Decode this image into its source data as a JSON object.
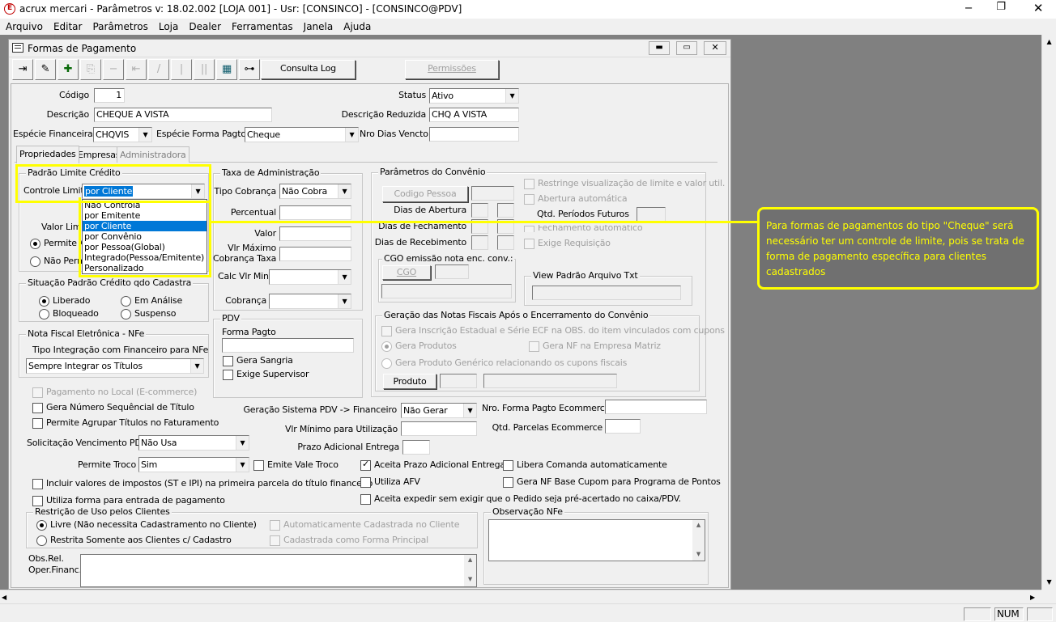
{
  "app": {
    "title": "acrux mercari - Parâmetros  v: 18.02.002  [LOJA 001] - Usr: [CONSINCO] - [CONSINCO@PDV]",
    "logo_letter": "E"
  },
  "menu": [
    "Arquivo",
    "Editar",
    "Parâmetros",
    "Loja",
    "Dealer",
    "Ferramentas",
    "Janela",
    "Ajuda"
  ],
  "child": {
    "title": "Formas de Pagamento"
  },
  "toolbar": {
    "consulta_log": "Consulta Log",
    "permissoes": "Permissões"
  },
  "form": {
    "codigo_label": "Código",
    "codigo_value": "1",
    "status_label": "Status",
    "status_value": "Ativo",
    "descricao_label": "Descrição",
    "descricao_value": "CHEQUE A VISTA",
    "desc_reduzida_label": "Descrição Reduzida",
    "desc_reduzida_value": "CHQ A VISTA",
    "especie_fin_label": "Espécie Financeira",
    "especie_fin_value": "CHQVIS",
    "especie_forma_label": "Espécie Forma Pagto",
    "especie_forma_value": "Cheque",
    "nro_dias_label": "Nro Dias Vencto",
    "nro_dias_value": ""
  },
  "tabs": [
    "Propriedades",
    "Empresas",
    "Administradora"
  ],
  "padrao_limite": {
    "title": "Padrão Limite Crédito",
    "controle_label": "Controle Limite",
    "controle_value": "por Cliente",
    "options": [
      "Não Controla",
      "por Emitente",
      "por Cliente",
      "por Convênio",
      "por Pessoa(Global)",
      "Integrado(Pessoa/Emitente)",
      "Personalizado"
    ],
    "valor_label": "Valor Limi",
    "permite_label": "Permite A",
    "nao_perm_label": "Não Perm"
  },
  "situacao": {
    "title": "Situação Padrão Crédito qdo Cadastra",
    "liberado": "Liberado",
    "em_analise": "Em Análise",
    "bloqueado": "Bloqueado",
    "suspenso": "Suspenso"
  },
  "nfe": {
    "title": "Nota Fiscal Eletrônica - NFe",
    "tipo_label": "Tipo Integração com Financeiro para NFe",
    "tipo_value": "Sempre Integrar os Títulos"
  },
  "taxa": {
    "title": "Taxa de Administração",
    "tipo_cobranca_label": "Tipo Cobrança",
    "tipo_cobranca_value": "Não Cobra",
    "percentual_label": "Percentual",
    "valor_label": "Valor",
    "vlr_max_label1": "Vlr Máximo",
    "vlr_max_label2": "Cobrança Taxa",
    "calc_label": "Calc Vlr Min",
    "cobranca_label": "Cobrança"
  },
  "pdv": {
    "title": "PDV",
    "forma_label": "Forma Pagto",
    "gera_sangria": "Gera Sangria",
    "exige_supervisor": "Exige Supervisor"
  },
  "convenio": {
    "title": "Parâmetros do Convênio",
    "codigo_pessoa_btn": "Codigo Pessoa",
    "dias_abertura": "Dias de Abertura",
    "dias_fechamento": "Dias de Fechamento",
    "dias_recebimento": "Dias de Recebimento",
    "restringe": "Restringe visualização de limite e valor util.",
    "abertura_auto": "Abertura automática",
    "qtd_periodos": "Qtd. Períodos Futuros",
    "fechamento_auto": "Fechamento automático",
    "exige_req": "Exige Requisição",
    "cgo_title": "CGO emissão nota enc. conv.:",
    "cgo_btn": "CGO",
    "view_title": "View Padrão Arquivo Txt"
  },
  "geracao_nf": {
    "title": "Geração das Notas Fiscais Após o Encerramento do Convênio",
    "gera_inscricao": "Gera Inscrição Estadual e Série ECF na OBS. do item vinculados com cupons",
    "gera_produtos": "Gera Produtos",
    "gera_nf_matriz": "Gera NF na Empresa Matriz",
    "gera_generico": "Gera Produto Genérico relacionando os cupons fiscais",
    "produto_btn": "Produto"
  },
  "options": {
    "pagamento_local": "Pagamento no Local (E-commerce)",
    "gera_numero": "Gera Número Sequêncial de Título",
    "permite_agrupar": "Permite Agrupar Títulos no Faturamento",
    "solicitacao_label": "Solicitação Vencimento PDV",
    "solicitacao_value": "Não Usa",
    "permite_troco_label": "Permite Troco",
    "permite_troco_value": "Sim",
    "emite_vale": "Emite Vale Troco",
    "incluir_impostos": "Incluir valores de impostos (ST e IPI) na primeira parcela do título financeiro",
    "utiliza_forma": "Utiliza forma para entrada de pagamento",
    "geracao_pdv_label": "Geração Sistema PDV -> Financeiro",
    "geracao_pdv_value": "Não Gerar",
    "nro_forma_label": "Nro. Forma Pagto Ecommerce",
    "vlr_minimo_label": "Vlr Mínimo para Utilização",
    "qtd_parcelas_label": "Qtd. Parcelas Ecommerce",
    "prazo_label": "Prazo Adicional Entrega",
    "aceita_prazo": "Aceita Prazo Adicional Entrega",
    "libera_comanda": "Libera Comanda automaticamente",
    "utiliza_afv": "Utiliza AFV",
    "gera_nf_base": "Gera NF Base Cupom para Programa de Pontos",
    "aceita_expedir": "Aceita expedir sem exigir que o Pedido seja pré-acertado no caixa/PDV."
  },
  "restricao": {
    "title": "Restrição de Uso pelos Clientes",
    "livre": "Livre (Não necessita Cadastramento no Cliente)",
    "restrita": "Restrita Somente aos Clientes c/ Cadastro",
    "auto_cadastrada": "Automaticamente Cadastrada no Cliente",
    "cadastrada_principal": "Cadastrada como Forma Principal"
  },
  "obs": {
    "label1": "Obs.Rel.",
    "label2": "Oper.Financ.",
    "nfe_title": "Observação NFe"
  },
  "callout": {
    "text": "Para formas de pagamentos do tipo \"Cheque\" será necessário ter um controle de limite, pois se trata de forma de pagamento específica para clientes cadastrados"
  },
  "status": {
    "num": "NUM"
  },
  "colors": {
    "highlight": "#ffff00",
    "callout_bg": "#707070",
    "selection": "#0078d7",
    "workspace": "#808080"
  }
}
